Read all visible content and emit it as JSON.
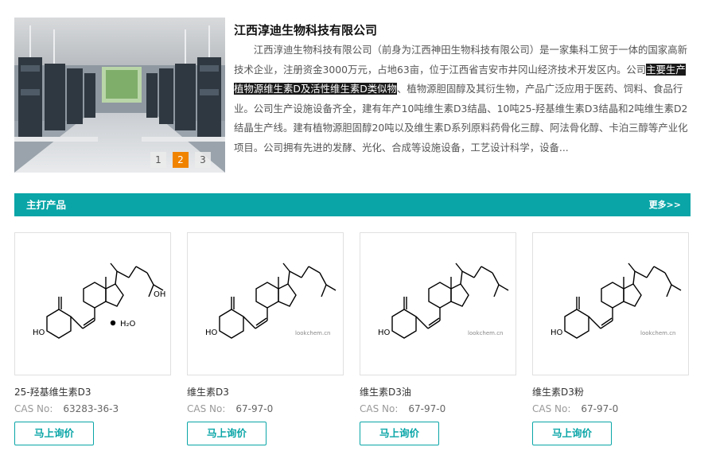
{
  "company": {
    "title": "江西淳迪生物科技有限公司",
    "desc_before": "江西淳迪生物科技有限公司（前身为江西神田生物科技有限公司）是一家集科工贸于一体的国家高新技术企业，注册资金3000万元，占地63亩，位于江西省吉安市井冈山经济技术开发区内。公司",
    "desc_highlight": "主要生产植物源维生素D及活性维生素D类似物",
    "desc_after": "、植物源胆固醇及其衍生物，产品广泛应用于医药、饲料、食品行业。公司生产设施设备齐全，建有年产10吨维生素D3结晶、10吨25-羟基维生素D3结晶和2吨维生素D2结晶生产线。建有植物源胆固醇20吨以及维生素D系列原料药骨化三醇、阿法骨化醇、卡泊三醇等产业化项目。公司拥有先进的发酵、光化、合成等设施设备，工艺设计科学，设备..."
  },
  "slider": {
    "pages": [
      "1",
      "2",
      "3"
    ],
    "active_index": 1,
    "watermark": "lookchem.cn"
  },
  "section": {
    "title": "主打产品",
    "more_label": "更多>>"
  },
  "products": [
    {
      "name": "25-羟基维生素D3",
      "cas_label": "CAS No:",
      "cas": "63283-36-3",
      "button": "马上询价",
      "watermark": "",
      "hydrate_label": "H₂O",
      "oh_label": "HO",
      "side_oh_label": "OH"
    },
    {
      "name": "维生素D3",
      "cas_label": "CAS No:",
      "cas": "67-97-0",
      "button": "马上询价",
      "watermark": "lookchem.cn",
      "oh_label": "HO"
    },
    {
      "name": "维生素D3油",
      "cas_label": "CAS No:",
      "cas": "67-97-0",
      "button": "马上询价",
      "watermark": "lookchem.cn",
      "oh_label": "HO"
    },
    {
      "name": "维生素D3粉",
      "cas_label": "CAS No:",
      "cas": "67-97-0",
      "button": "马上询价",
      "watermark": "lookchem.cn",
      "oh_label": "HO"
    }
  ],
  "colors": {
    "accent": "#0aa5a7",
    "active_dot": "#f08300"
  }
}
